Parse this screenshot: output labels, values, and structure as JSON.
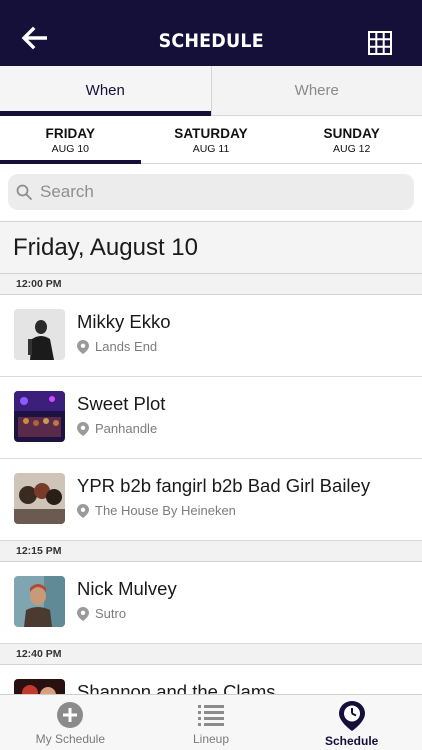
{
  "header": {
    "title": "SCHEDULE",
    "back_icon": "back-arrow-icon",
    "grid_icon": "grid-icon"
  },
  "segments": [
    {
      "label": "When",
      "active": true
    },
    {
      "label": "Where",
      "active": false
    }
  ],
  "days": [
    {
      "day": "FRIDAY",
      "date": "AUG 10",
      "active": true
    },
    {
      "day": "SATURDAY",
      "date": "AUG 11",
      "active": false
    },
    {
      "day": "SUNDAY",
      "date": "AUG 12",
      "active": false
    }
  ],
  "search": {
    "placeholder": "Search",
    "icon": "search-icon"
  },
  "date_heading": "Friday, August 10",
  "schedule": [
    {
      "time": "12:00 PM",
      "artists": [
        {
          "name": "Mikky Ekko",
          "venue": "Lands End"
        },
        {
          "name": "Sweet Plot",
          "venue": "Panhandle"
        },
        {
          "name": "YPR b2b fangirl b2b Bad Girl Bailey",
          "venue": "The House By Heineken"
        }
      ]
    },
    {
      "time": "12:15 PM",
      "artists": [
        {
          "name": "Nick Mulvey",
          "venue": "Sutro"
        }
      ]
    },
    {
      "time": "12:40 PM",
      "artists": [
        {
          "name": "Shannon and the Clams",
          "venue": ""
        }
      ]
    }
  ],
  "bottom_nav": [
    {
      "label": "My Schedule",
      "icon": "add-circle-icon",
      "active": false
    },
    {
      "label": "Lineup",
      "icon": "list-icon",
      "active": false
    },
    {
      "label": "Schedule",
      "icon": "clock-pin-icon",
      "active": true
    }
  ],
  "colors": {
    "brand": "#15103a",
    "background": "#ffffff",
    "muted": "#7c7c7c"
  }
}
